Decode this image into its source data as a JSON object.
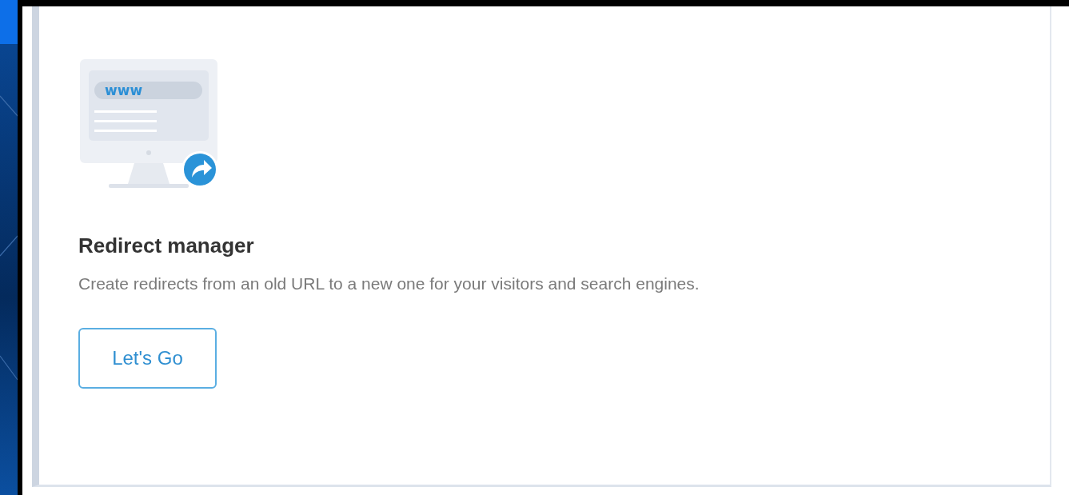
{
  "card": {
    "illustration_label": "www",
    "title": "Redirect manager",
    "description": "Create redirects from an old URL to a new one for your visitors and search engines.",
    "button": "Let's Go"
  }
}
